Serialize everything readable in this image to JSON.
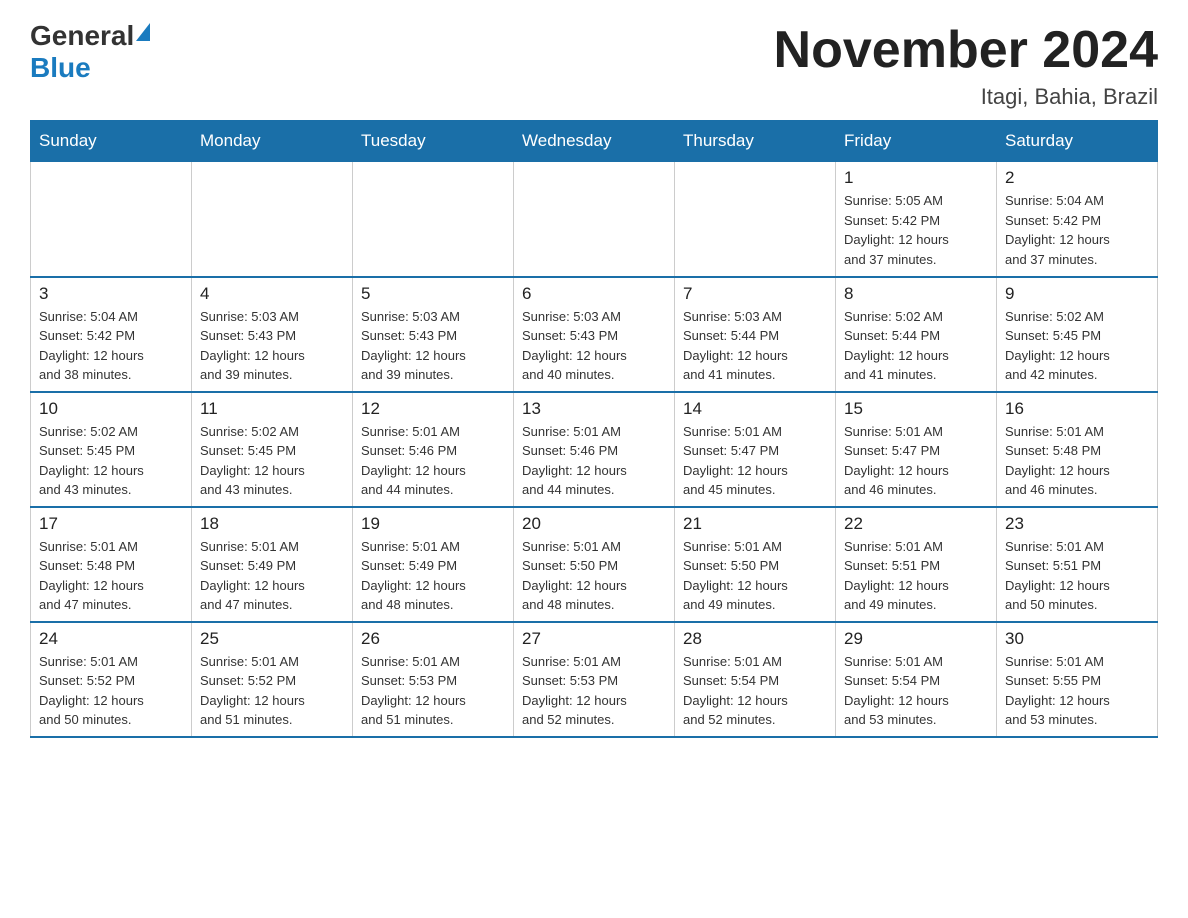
{
  "logo": {
    "general": "General",
    "blue": "Blue"
  },
  "title": "November 2024",
  "location": "Itagi, Bahia, Brazil",
  "weekdays": [
    "Sunday",
    "Monday",
    "Tuesday",
    "Wednesday",
    "Thursday",
    "Friday",
    "Saturday"
  ],
  "weeks": [
    [
      {
        "day": "",
        "info": ""
      },
      {
        "day": "",
        "info": ""
      },
      {
        "day": "",
        "info": ""
      },
      {
        "day": "",
        "info": ""
      },
      {
        "day": "",
        "info": ""
      },
      {
        "day": "1",
        "info": "Sunrise: 5:05 AM\nSunset: 5:42 PM\nDaylight: 12 hours\nand 37 minutes."
      },
      {
        "day": "2",
        "info": "Sunrise: 5:04 AM\nSunset: 5:42 PM\nDaylight: 12 hours\nand 37 minutes."
      }
    ],
    [
      {
        "day": "3",
        "info": "Sunrise: 5:04 AM\nSunset: 5:42 PM\nDaylight: 12 hours\nand 38 minutes."
      },
      {
        "day": "4",
        "info": "Sunrise: 5:03 AM\nSunset: 5:43 PM\nDaylight: 12 hours\nand 39 minutes."
      },
      {
        "day": "5",
        "info": "Sunrise: 5:03 AM\nSunset: 5:43 PM\nDaylight: 12 hours\nand 39 minutes."
      },
      {
        "day": "6",
        "info": "Sunrise: 5:03 AM\nSunset: 5:43 PM\nDaylight: 12 hours\nand 40 minutes."
      },
      {
        "day": "7",
        "info": "Sunrise: 5:03 AM\nSunset: 5:44 PM\nDaylight: 12 hours\nand 41 minutes."
      },
      {
        "day": "8",
        "info": "Sunrise: 5:02 AM\nSunset: 5:44 PM\nDaylight: 12 hours\nand 41 minutes."
      },
      {
        "day": "9",
        "info": "Sunrise: 5:02 AM\nSunset: 5:45 PM\nDaylight: 12 hours\nand 42 minutes."
      }
    ],
    [
      {
        "day": "10",
        "info": "Sunrise: 5:02 AM\nSunset: 5:45 PM\nDaylight: 12 hours\nand 43 minutes."
      },
      {
        "day": "11",
        "info": "Sunrise: 5:02 AM\nSunset: 5:45 PM\nDaylight: 12 hours\nand 43 minutes."
      },
      {
        "day": "12",
        "info": "Sunrise: 5:01 AM\nSunset: 5:46 PM\nDaylight: 12 hours\nand 44 minutes."
      },
      {
        "day": "13",
        "info": "Sunrise: 5:01 AM\nSunset: 5:46 PM\nDaylight: 12 hours\nand 44 minutes."
      },
      {
        "day": "14",
        "info": "Sunrise: 5:01 AM\nSunset: 5:47 PM\nDaylight: 12 hours\nand 45 minutes."
      },
      {
        "day": "15",
        "info": "Sunrise: 5:01 AM\nSunset: 5:47 PM\nDaylight: 12 hours\nand 46 minutes."
      },
      {
        "day": "16",
        "info": "Sunrise: 5:01 AM\nSunset: 5:48 PM\nDaylight: 12 hours\nand 46 minutes."
      }
    ],
    [
      {
        "day": "17",
        "info": "Sunrise: 5:01 AM\nSunset: 5:48 PM\nDaylight: 12 hours\nand 47 minutes."
      },
      {
        "day": "18",
        "info": "Sunrise: 5:01 AM\nSunset: 5:49 PM\nDaylight: 12 hours\nand 47 minutes."
      },
      {
        "day": "19",
        "info": "Sunrise: 5:01 AM\nSunset: 5:49 PM\nDaylight: 12 hours\nand 48 minutes."
      },
      {
        "day": "20",
        "info": "Sunrise: 5:01 AM\nSunset: 5:50 PM\nDaylight: 12 hours\nand 48 minutes."
      },
      {
        "day": "21",
        "info": "Sunrise: 5:01 AM\nSunset: 5:50 PM\nDaylight: 12 hours\nand 49 minutes."
      },
      {
        "day": "22",
        "info": "Sunrise: 5:01 AM\nSunset: 5:51 PM\nDaylight: 12 hours\nand 49 minutes."
      },
      {
        "day": "23",
        "info": "Sunrise: 5:01 AM\nSunset: 5:51 PM\nDaylight: 12 hours\nand 50 minutes."
      }
    ],
    [
      {
        "day": "24",
        "info": "Sunrise: 5:01 AM\nSunset: 5:52 PM\nDaylight: 12 hours\nand 50 minutes."
      },
      {
        "day": "25",
        "info": "Sunrise: 5:01 AM\nSunset: 5:52 PM\nDaylight: 12 hours\nand 51 minutes."
      },
      {
        "day": "26",
        "info": "Sunrise: 5:01 AM\nSunset: 5:53 PM\nDaylight: 12 hours\nand 51 minutes."
      },
      {
        "day": "27",
        "info": "Sunrise: 5:01 AM\nSunset: 5:53 PM\nDaylight: 12 hours\nand 52 minutes."
      },
      {
        "day": "28",
        "info": "Sunrise: 5:01 AM\nSunset: 5:54 PM\nDaylight: 12 hours\nand 52 minutes."
      },
      {
        "day": "29",
        "info": "Sunrise: 5:01 AM\nSunset: 5:54 PM\nDaylight: 12 hours\nand 53 minutes."
      },
      {
        "day": "30",
        "info": "Sunrise: 5:01 AM\nSunset: 5:55 PM\nDaylight: 12 hours\nand 53 minutes."
      }
    ]
  ]
}
